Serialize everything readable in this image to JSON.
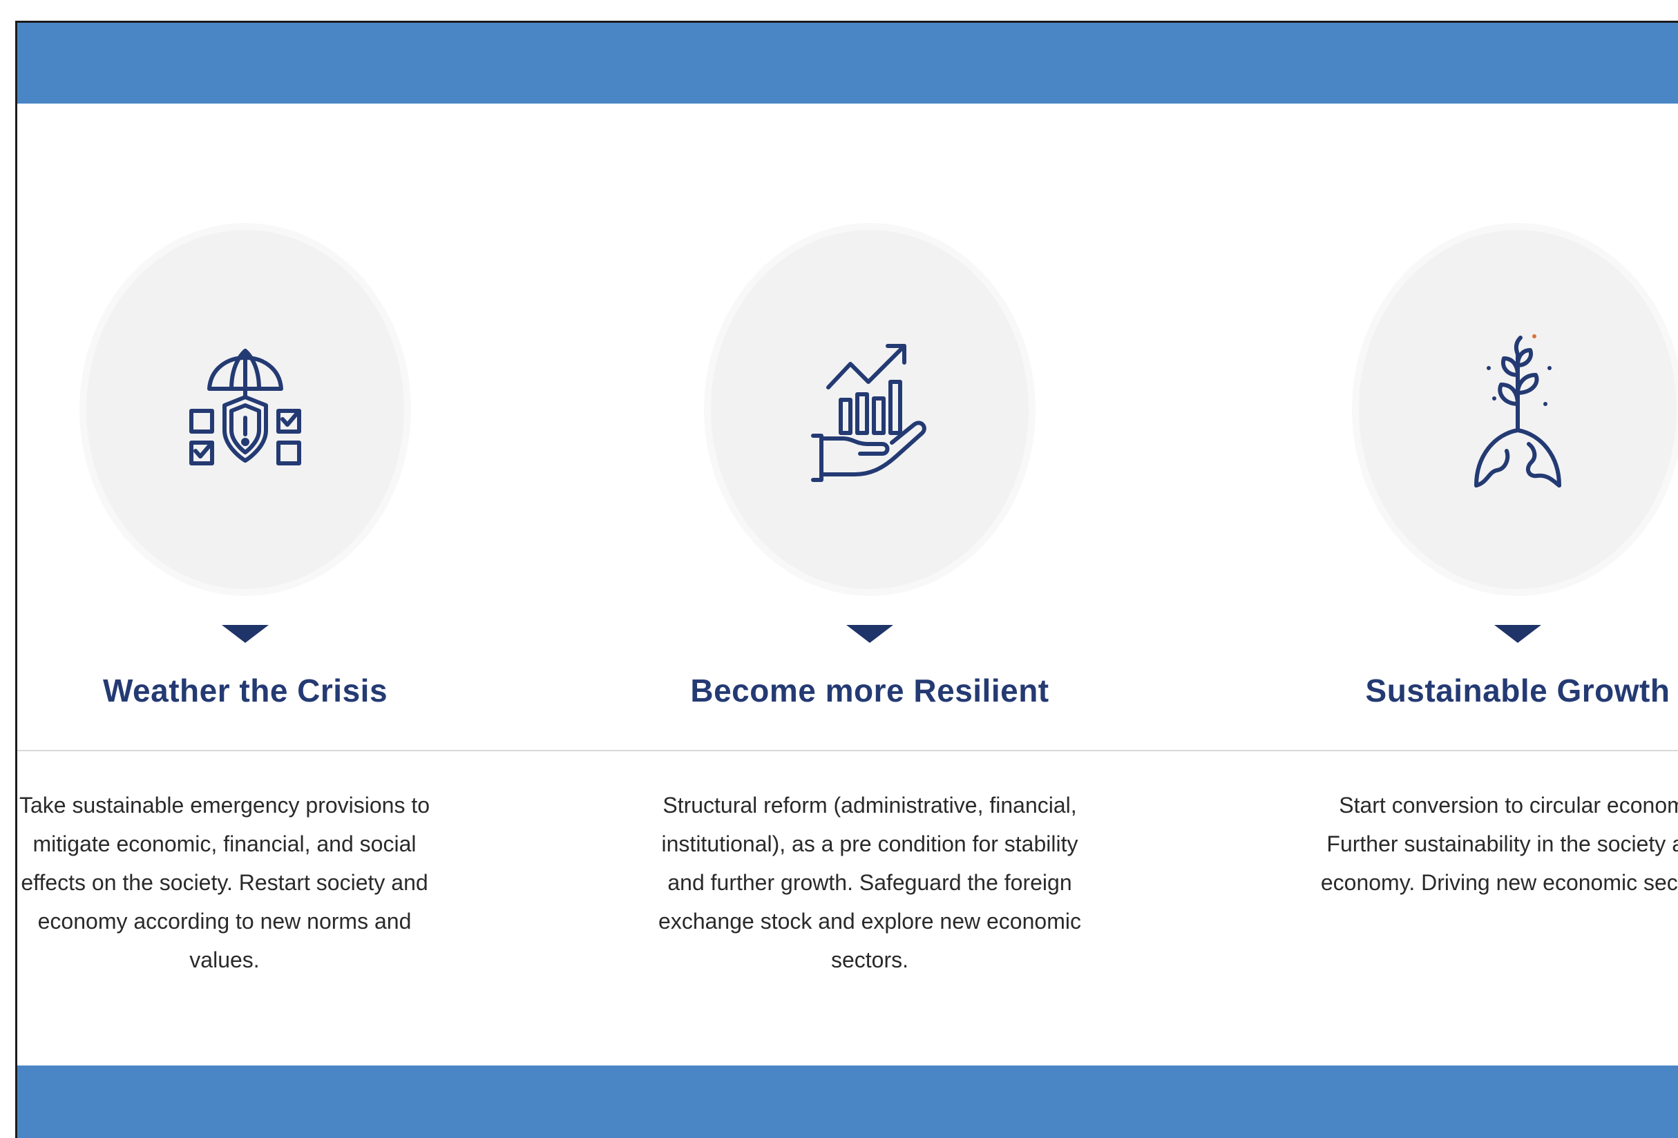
{
  "colors": {
    "band": "#4a86c5",
    "icon": "#243a73",
    "circle": "#f2f2f3"
  },
  "pillars": [
    {
      "icon": "umbrella-shield-checklist-icon",
      "title": "Weather the Crisis",
      "description": "Take sustainable emergency provisions to mitigate economic, financial, and social effects on the society. Restart society and economy according to new norms and values."
    },
    {
      "icon": "hand-growth-chart-icon",
      "title": "Become more Resilient",
      "description": "Structural reform (administrative, financial, institutional), as a pre condition for stability and further growth. Safeguard the foreign exchange stock and explore new economic sectors."
    },
    {
      "icon": "globe-sprout-icon",
      "title": "Sustainable Growth",
      "description": "Start conversion to circular economy Further sustainability in the society and economy. Driving new economic sectors"
    }
  ]
}
